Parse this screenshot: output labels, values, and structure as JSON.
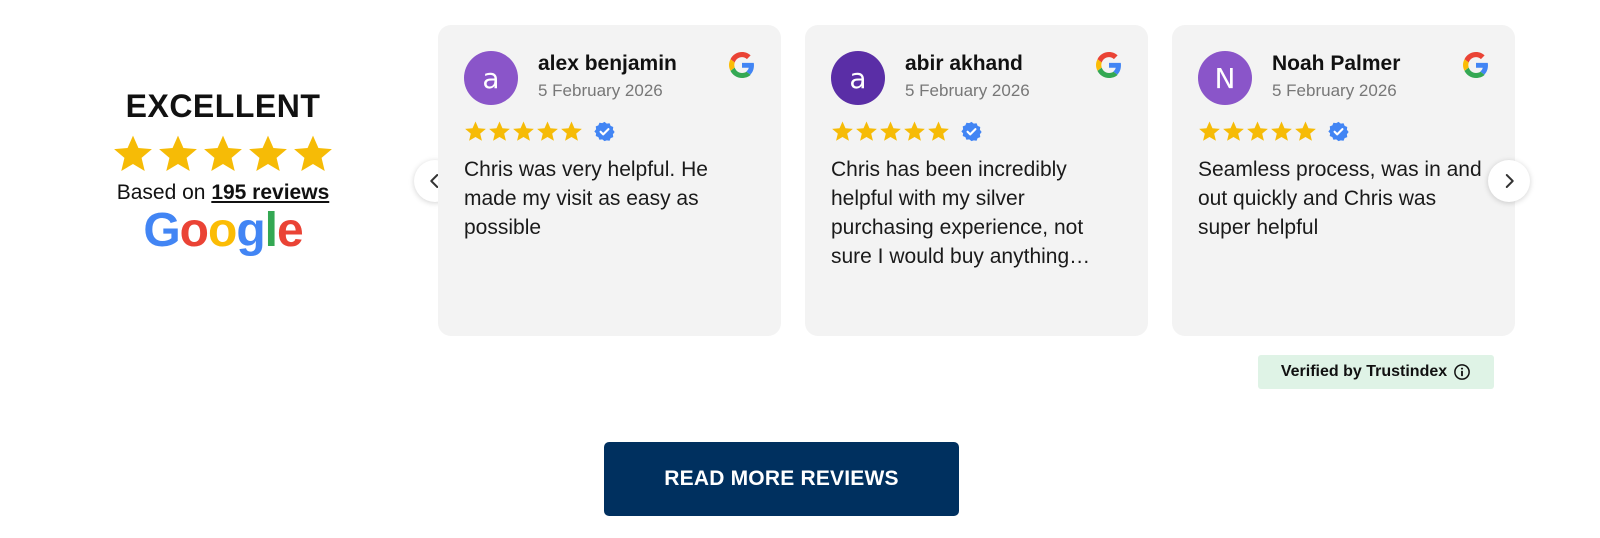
{
  "summary": {
    "rating_word": "EXCELLENT",
    "stars": 5,
    "based_on_prefix": "Based on ",
    "review_count_link": "195 reviews",
    "google_letters": [
      "G",
      "o",
      "o",
      "g",
      "l",
      "e"
    ],
    "google_colors": [
      "#4285F4",
      "#EA4335",
      "#FBBC05",
      "#4285F4",
      "#34A853",
      "#EA4335"
    ]
  },
  "colors": {
    "star": "#F6BB06",
    "verified_check": "#4285F4",
    "button_bg": "#00305f",
    "card_bg": "#f3f3f3"
  },
  "reviews": [
    {
      "initial": "a",
      "avatar_color": "#8a55c9",
      "name": "alex benjamin",
      "date": "5 February 2026",
      "stars": 5,
      "text": "Chris was very helpful. He made my visit as easy as possible"
    },
    {
      "initial": "a",
      "avatar_color": "#5a2ea6",
      "name": "abir akhand",
      "date": "5 February 2026",
      "stars": 5,
      "text": "Chris has been incredibly helpful with my silver purchasing experience, not sure I would buy anything…"
    },
    {
      "initial": "N",
      "avatar_color": "#8a55c9",
      "name": "Noah Palmer",
      "date": "5 February 2026",
      "stars": 5,
      "text": "Seamless process, was in and out quickly and Chris was super helpful"
    }
  ],
  "carousel": {
    "prev_icon": "chevron-left-icon",
    "next_icon": "chevron-right-icon"
  },
  "verified_badge": "Verified by Trustindex",
  "read_more_label": "READ MORE REVIEWS"
}
